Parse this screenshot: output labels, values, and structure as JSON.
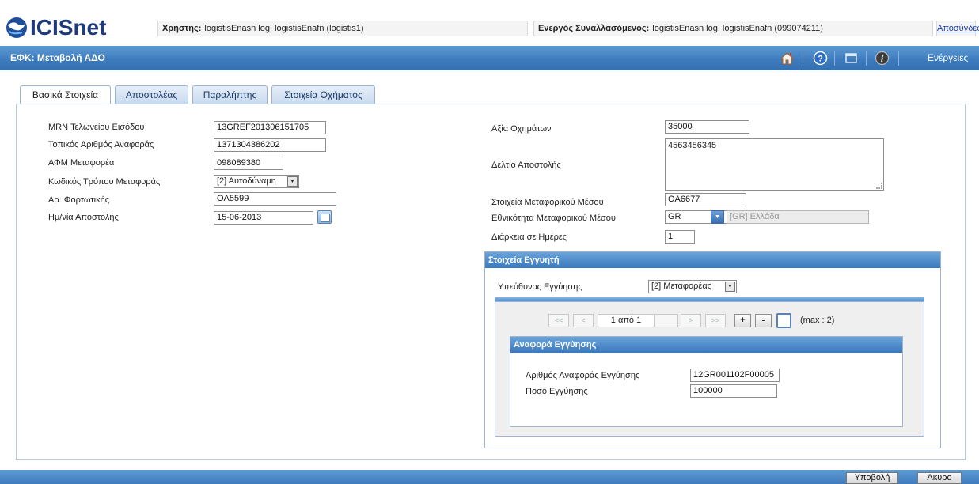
{
  "header": {
    "logo_text": "ICISnet",
    "user_label": "Χρήστης:",
    "user_value": "logistisEnasn log. logistisEnafn (logistis1)",
    "trader_label": "Ενεργός Συναλλασόμενος:",
    "trader_value": "logistisEnasn log. logistisEnafn (099074211)",
    "logout": "Αποσύνδεση"
  },
  "titlebar": {
    "title": "ΕΦΚ: Μεταβολή ΑΔΟ",
    "actions": "Ενέργειες",
    "icons": [
      "home-icon",
      "help-icon",
      "window-icon",
      "info-icon"
    ]
  },
  "tabs": [
    {
      "label": "Βασικά Στοιχεία",
      "active": true
    },
    {
      "label": "Αποστολέας",
      "active": false
    },
    {
      "label": "Παραλήπτης",
      "active": false
    },
    {
      "label": "Στοιχεία Οχήματος",
      "active": false
    }
  ],
  "left_form": {
    "mrn_label": "MRN Τελωνείου Εισόδου",
    "mrn_value": "13GREF201306151705",
    "local_ref_label": "Τοπικός Αριθμός Αναφοράς",
    "local_ref_value": "1371304386202",
    "afm_label": "ΑΦΜ Μεταφορέα",
    "afm_value": "098089380",
    "transport_code_label": "Κωδικός Τρόπου Μεταφοράς",
    "transport_code_value": "[2] Αυτοδύναμη",
    "waybill_label": "Αρ. Φορτωτικής",
    "waybill_value": "OA5599",
    "dispatch_date_label": "Ημ/νία Αποστολής",
    "dispatch_date_value": "15-06-2013"
  },
  "right_form": {
    "vehicle_value_label": "Αξία Οχημάτων",
    "vehicle_value_value": "35000",
    "delivery_note_label": "Δελτίο Αποστολής",
    "delivery_note_value": "4563456345",
    "transport_means_label": "Στοιχεία Μεταφορικού Μέσου",
    "transport_means_value": "OA6677",
    "nationality_label": "Εθνικότητα Μεταφορικού Μέσου",
    "nationality_value": "GR",
    "nationality_desc": "[GR] Ελλάδα",
    "duration_label": "Διάρκεια σε Ημέρες",
    "duration_value": "1"
  },
  "guarantor": {
    "title": "Στοιχεία Εγγυητή",
    "responsible_label": "Υπεύθυνος Εγγύησης",
    "responsible_value": "[2] Μεταφορέας",
    "pager": {
      "first": "<<",
      "prev": "<",
      "page_text": "1 από 1",
      "next": ">",
      "last": ">>",
      "add": "+",
      "remove": "-",
      "max_text": "(max : 2)"
    },
    "reference": {
      "title": "Αναφορά Εγγύησης",
      "ref_no_label": "Αριθμός Αναφοράς Εγγύησης",
      "ref_no_value": "12GR001102F00005",
      "amount_label": "Ποσό Εγγύησης",
      "amount_value": "100000"
    }
  },
  "footer": {
    "submit": "Υποβολή",
    "cancel": "Άκυρο"
  }
}
